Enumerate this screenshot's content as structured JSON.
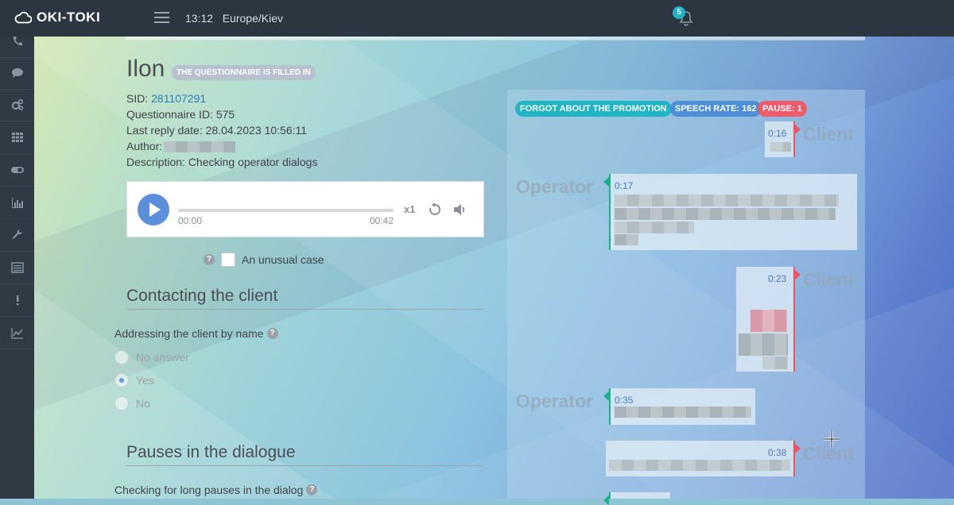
{
  "header": {
    "logo_text": "OKI-TOKI",
    "time": "13:12",
    "timezone": "Europe/Kiev",
    "notification_count": "5"
  },
  "sidebar": {
    "icons": [
      "phone-icon",
      "chat-icon",
      "gears-icon",
      "grid-icon",
      "toggle-icon",
      "bar-chart-icon",
      "wrench-icon",
      "list-icon",
      "exclamation-icon",
      "line-chart-icon"
    ]
  },
  "record": {
    "name": "Ilon",
    "status_badge": "THE QUESTIONNAIRE IS FILLED IN",
    "sid_label": "SID:",
    "sid_value": "281107291",
    "questionnaire_label": "Questionnaire ID:",
    "questionnaire_value": "575",
    "last_reply_label": "Last reply date:",
    "last_reply_value": "28.04.2023 10:56:11",
    "author_label": "Author:",
    "description_label": "Description:",
    "description_value": "Checking operator dialogs"
  },
  "player": {
    "current_time": "00:00",
    "duration": "00:42",
    "speed": "x1",
    "progress": 0
  },
  "unusual_case": {
    "label": "An unusual case",
    "checked": false
  },
  "sections": [
    {
      "title": "Contacting the client",
      "question": "Addressing the client by name",
      "options": [
        "No answer",
        "Yes",
        "No"
      ],
      "selected": "Yes"
    },
    {
      "title": "Pauses in the dialogue",
      "question": "Checking for long pauses in the dialog"
    }
  ],
  "dialog": {
    "tags": [
      "FORGOT ABOUT THE PROMOTION",
      "SPEECH RATE: 162",
      "PAUSE: 1"
    ],
    "tag_colors": [
      "#1fb5c4",
      "#4c8fd6",
      "#ef5b6b"
    ],
    "speaker_client": "Client",
    "speaker_operator": "Operator",
    "messages": [
      {
        "speaker": "Client",
        "time": "0:16"
      },
      {
        "speaker": "Operator",
        "time": "0:17"
      },
      {
        "speaker": "Client",
        "time": "0:23"
      },
      {
        "speaker": "Operator",
        "time": "0:35"
      },
      {
        "speaker": "Client",
        "time": "0:38"
      }
    ]
  }
}
